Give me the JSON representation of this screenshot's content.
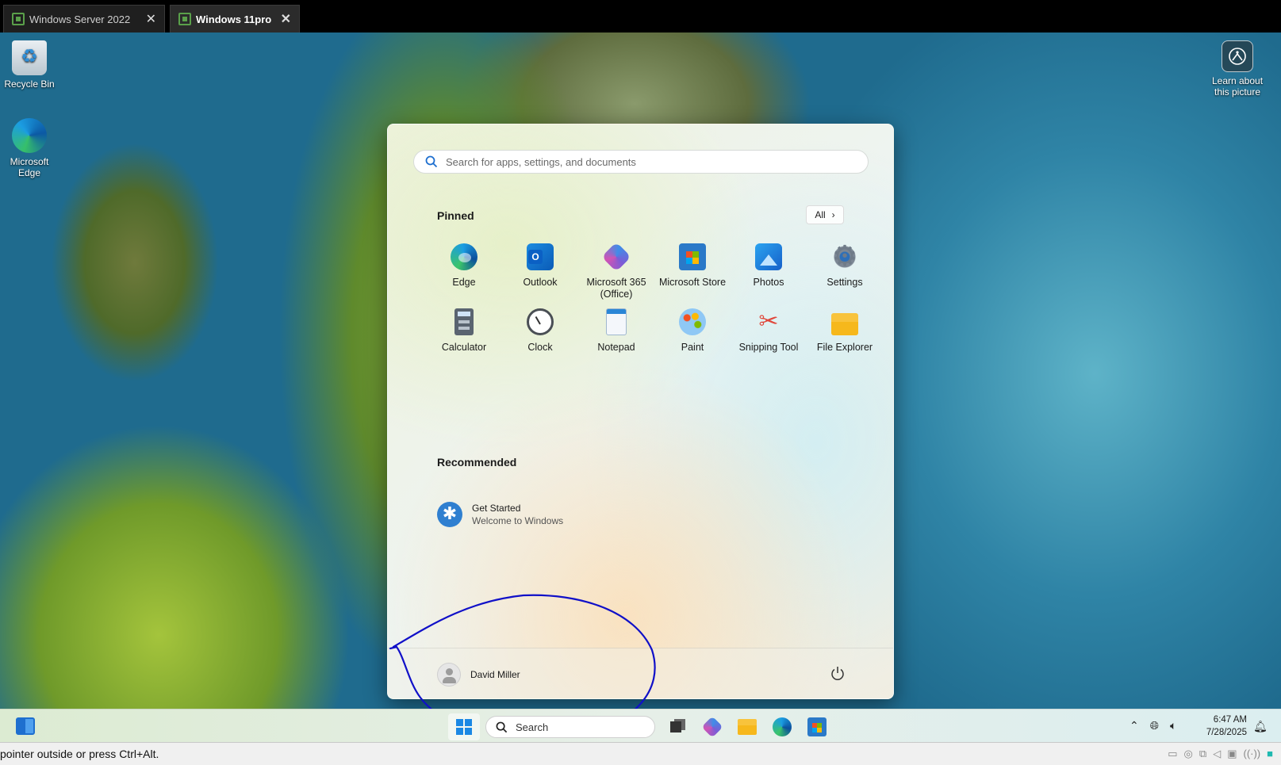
{
  "vm_tabs": [
    {
      "label": "Windows Server 2022",
      "close": "✕",
      "active": false
    },
    {
      "label": "Windows 11pro",
      "close": "✕",
      "active": true
    }
  ],
  "desktop": {
    "icons": [
      {
        "label": "Recycle Bin",
        "icon": "recycle-bin-icon"
      },
      {
        "label": "Microsoft Edge",
        "icon": "edge-icon"
      }
    ],
    "learn_about": "Learn about this picture"
  },
  "start_menu": {
    "search_placeholder": "Search for apps, settings, and documents",
    "pinned_title": "Pinned",
    "all_label": "All",
    "pinned": [
      {
        "label": "Edge",
        "icon": "edge"
      },
      {
        "label": "Outlook",
        "icon": "outlook"
      },
      {
        "label": "Microsoft 365 (Office)",
        "icon": "m365"
      },
      {
        "label": "Microsoft Store",
        "icon": "store"
      },
      {
        "label": "Photos",
        "icon": "photos"
      },
      {
        "label": "Settings",
        "icon": "settings"
      },
      {
        "label": "Calculator",
        "icon": "calculator"
      },
      {
        "label": "Clock",
        "icon": "clock"
      },
      {
        "label": "Notepad",
        "icon": "notepad"
      },
      {
        "label": "Paint",
        "icon": "paint"
      },
      {
        "label": "Snipping Tool",
        "icon": "snip"
      },
      {
        "label": "File Explorer",
        "icon": "explorer"
      }
    ],
    "recommended_title": "Recommended",
    "recommended": [
      {
        "title": "Get Started",
        "subtitle": "Welcome to Windows"
      }
    ],
    "user_name": "David Miller"
  },
  "taskbar": {
    "search_label": "Search",
    "time": "6:47 AM",
    "date": "7/28/2025"
  },
  "status_bar": {
    "message": "pointer outside or press Ctrl+Alt."
  },
  "colors": {
    "annotation": "#1010c8",
    "accent": "#1b88e4"
  }
}
